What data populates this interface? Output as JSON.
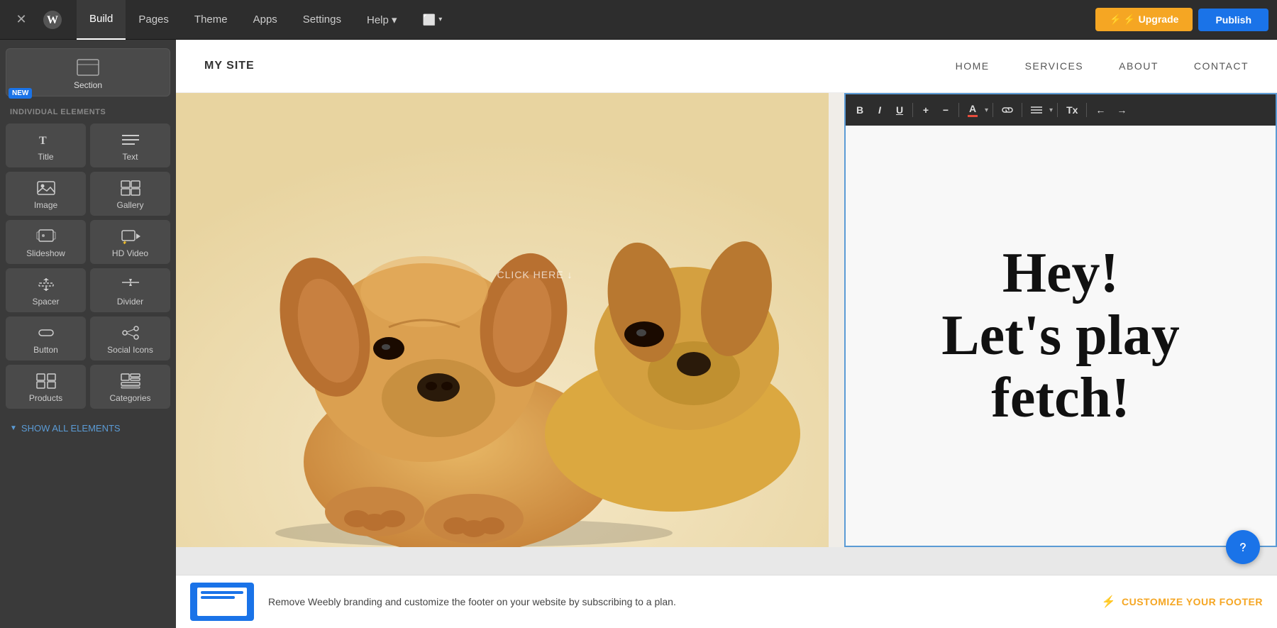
{
  "topNav": {
    "close_label": "✕",
    "tabs": [
      {
        "id": "build",
        "label": "Build",
        "active": true
      },
      {
        "id": "pages",
        "label": "Pages"
      },
      {
        "id": "theme",
        "label": "Theme"
      },
      {
        "id": "apps",
        "label": "Apps"
      },
      {
        "id": "settings",
        "label": "Settings"
      },
      {
        "id": "help",
        "label": "Help ▾"
      },
      {
        "id": "device",
        "label": "⬜ ▾"
      }
    ],
    "upgrade_label": "⚡ Upgrade",
    "publish_label": "Publish"
  },
  "sidebar": {
    "new_badge": "NEW",
    "section_label": "Section",
    "individual_elements_label": "INDIVIDUAL ELEMENTS",
    "elements": [
      {
        "id": "title",
        "label": "Title"
      },
      {
        "id": "text",
        "label": "Text"
      },
      {
        "id": "image",
        "label": "Image"
      },
      {
        "id": "gallery",
        "label": "Gallery"
      },
      {
        "id": "slideshow",
        "label": "Slideshow"
      },
      {
        "id": "hd-video",
        "label": "HD Video"
      },
      {
        "id": "spacer",
        "label": "Spacer"
      },
      {
        "id": "divider",
        "label": "Divider"
      },
      {
        "id": "button",
        "label": "Button"
      },
      {
        "id": "social-icons",
        "label": "Social Icons"
      },
      {
        "id": "products",
        "label": "Products"
      },
      {
        "id": "categories",
        "label": "Categories"
      }
    ],
    "show_all_label": "SHOW ALL ELEMENTS"
  },
  "siteHeader": {
    "logo": "MY SITE",
    "nav": [
      "HOME",
      "SERVICES",
      "ABOUT",
      "CONTACT"
    ]
  },
  "toolbar": {
    "bold": "B",
    "italic": "I",
    "underline": "U",
    "add": "+",
    "remove": "−",
    "color": "A",
    "link": "🔗",
    "align": "≡",
    "tx": "Tx",
    "undo": "←",
    "redo": "→"
  },
  "hero": {
    "headline_line1": "Hey!",
    "headline_line2": "Let's play",
    "headline_line3": "fetch!",
    "click_hint": "CLICK HERE ↓"
  },
  "footerBanner": {
    "message": "Remove Weebly branding and customize the footer on your website by subscribing to a plan.",
    "cta_label": "CUSTOMIZE YOUR FOOTER"
  },
  "colors": {
    "accent_blue": "#1a73e8",
    "accent_orange": "#f5a623",
    "active_border": "#5b9bd5",
    "nav_bg": "#2d2d2d",
    "sidebar_bg": "#3a3a3a"
  }
}
